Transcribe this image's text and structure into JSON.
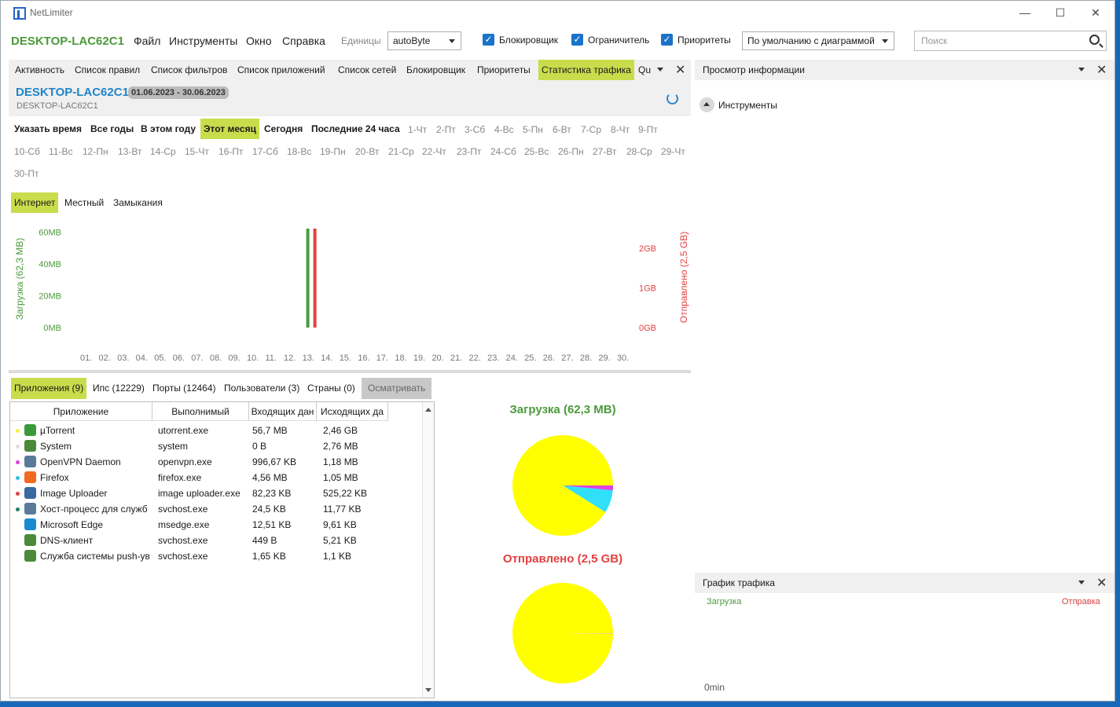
{
  "window": {
    "app_name": "NetLimiter",
    "controls": {
      "minimize": "—",
      "maximize": "☐",
      "close": "✕"
    }
  },
  "menubar": {
    "host": "DESKTOP-LAC62C1",
    "menus": [
      "Файл",
      "Инструменты",
      "Окно",
      "Справка"
    ],
    "units_label": "Единицы",
    "units_value": "autoByte",
    "checkboxes": [
      {
        "label": "Блокировщик",
        "checked": true
      },
      {
        "label": "Ограничитель",
        "checked": true
      },
      {
        "label": "Приоритеты",
        "checked": true
      }
    ],
    "profile_value": "По умолчанию с диаграммой",
    "search_placeholder": "Поиск"
  },
  "tabs": [
    "Активность",
    "Список правил",
    "Список фильтров",
    "Список приложений",
    "Список сетей",
    "Блокировщик",
    "Приоритеты",
    "Статистика трафика",
    "Qu"
  ],
  "active_tab": "Статистика трафика",
  "stats_header": {
    "host": "DESKTOP-LAC62C1",
    "date_range": "01.06.2023 - 30.06.2023",
    "host_sub": "DESKTOP-LAC62C1"
  },
  "range_buttons": [
    "Указать время",
    "Все годы",
    "В этом году",
    "Этот месяц",
    "Сегодня",
    "Последние 24 часа"
  ],
  "active_range": "Этот месяц",
  "days": [
    "1-Чт",
    "2-Пт",
    "3-Сб",
    "4-Вс",
    "5-Пн",
    "6-Вт",
    "7-Ср",
    "8-Чт",
    "9-Пт",
    "10-Сб",
    "11-Вс",
    "12-Пн",
    "13-Вт",
    "14-Ср",
    "15-Чт",
    "16-Пт",
    "17-Сб",
    "18-Вс",
    "19-Пн",
    "20-Вт",
    "21-Ср",
    "22-Чт",
    "23-Пт",
    "24-Сб",
    "25-Вс",
    "26-Пн",
    "27-Вт",
    "28-Ср",
    "29-Чт",
    "30-Пт"
  ],
  "scope_tabs": [
    "Интернет",
    "Местный",
    "Замыкания"
  ],
  "active_scope": "Интернет",
  "chart_data": {
    "type": "bar",
    "categories": [
      "01.",
      "02.",
      "03.",
      "04.",
      "05.",
      "06.",
      "07.",
      "08.",
      "09.",
      "10.",
      "11.",
      "12.",
      "13.",
      "14.",
      "15.",
      "16.",
      "17.",
      "18.",
      "19.",
      "20.",
      "21.",
      "22.",
      "23.",
      "24.",
      "25.",
      "26.",
      "27.",
      "28.",
      "29.",
      "30."
    ],
    "series": [
      {
        "name": "Загрузка (62,3 MB)",
        "color": "#4a9a3a",
        "axis": "left",
        "unit": "MB",
        "values": [
          0,
          0,
          0,
          0,
          0,
          0,
          0,
          0,
          0,
          0,
          0,
          0,
          62.3,
          0,
          0,
          0,
          0,
          0,
          0,
          0,
          0,
          0,
          0,
          0,
          0,
          0,
          0,
          0,
          0,
          0
        ]
      },
      {
        "name": "Отправлено (2,5 GB)",
        "color": "#e34040",
        "axis": "right",
        "unit": "GB",
        "values": [
          0,
          0,
          0,
          0,
          0,
          0,
          0,
          0,
          0,
          0,
          0,
          0,
          2.5,
          0,
          0,
          0,
          0,
          0,
          0,
          0,
          0,
          0,
          0,
          0,
          0,
          0,
          0,
          0,
          0,
          0
        ]
      }
    ],
    "ylabel_left": "Загрузка (62,3 MB)",
    "ylabel_right": "Отправлено (2,5 GB)",
    "yticks_left": [
      "0MB",
      "20MB",
      "40MB",
      "60MB"
    ],
    "yticks_right": [
      "0GB",
      "1GB",
      "2GB"
    ],
    "ylim_left": [
      0,
      62.3
    ],
    "ylim_right": [
      0,
      2.5
    ]
  },
  "bottom_tabs": [
    "Приложения (9)",
    "Ипс (12229)",
    "Порты (12464)",
    "Пользователи (3)",
    "Страны (0)"
  ],
  "active_bottom_tab": "Приложения (9)",
  "inspect_button": "Осматривать",
  "table": {
    "columns": [
      "Приложение",
      "Выполнимый",
      "Входящих дан",
      "Исходящих да"
    ],
    "rows": [
      {
        "name": "µTorrent",
        "exe": "utorrent.exe",
        "in": "56,7 MB",
        "out": "2,46 GB",
        "dot": "#f2f244",
        "icon": "#3a9a3a"
      },
      {
        "name": "System",
        "exe": "system",
        "in": "0 B",
        "out": "2,76 MB",
        "dot": "#e6d6e6",
        "icon": "#4a8a3a"
      },
      {
        "name": "OpenVPN Daemon",
        "exe": "openvpn.exe",
        "in": "996,67 KB",
        "out": "1,18 MB",
        "dot": "#e040e0",
        "icon": "#5a7a9a"
      },
      {
        "name": "Firefox",
        "exe": "firefox.exe",
        "in": "4,56 MB",
        "out": "1,05 MB",
        "dot": "#30c0e0",
        "icon": "#f06a20"
      },
      {
        "name": "Image Uploader",
        "exe": "image uploader.exe",
        "in": "82,23 KB",
        "out": "525,22 KB",
        "dot": "#e04040",
        "icon": "#3a6aa0"
      },
      {
        "name": "Хост-процесс для служб",
        "exe": "svchost.exe",
        "in": "24,5 KB",
        "out": "11,77 KB",
        "dot": "#208060",
        "icon": "#5a7a9a"
      },
      {
        "name": "Microsoft Edge",
        "exe": "msedge.exe",
        "in": "12,51 KB",
        "out": "9,61 KB",
        "dot": "#ffffff",
        "icon": "#1a8ad0"
      },
      {
        "name": "DNS-клиент",
        "exe": "svchost.exe",
        "in": "449 B",
        "out": "5,21 KB",
        "dot": "#ffffff",
        "icon": "#4a8a3a"
      },
      {
        "name": "Служба системы push-ув",
        "exe": "svchost.exe",
        "in": "1,65 KB",
        "out": "1,1 KB",
        "dot": "#ffffff",
        "icon": "#4a8a3a"
      }
    ]
  },
  "pies": [
    {
      "title": "Загрузка (62,3 MB)",
      "color": "#4a9a3a",
      "slices": [
        {
          "label": "µTorrent",
          "value": 56.7,
          "color": "#ffff00"
        },
        {
          "label": "Firefox",
          "value": 4.56,
          "color": "#30e0f8"
        },
        {
          "label": "OpenVPN Daemon",
          "value": 0.97,
          "color": "#e040e0"
        }
      ]
    },
    {
      "title": "Отправлено (2,5 GB)",
      "color": "#e34040",
      "slices": [
        {
          "label": "µTorrent",
          "value": 2460,
          "color": "#ffff00"
        },
        {
          "label": "System",
          "value": 2.76,
          "color": "#e6d6e6"
        },
        {
          "label": "OpenVPN Daemon",
          "value": 1.18,
          "color": "#e040e0"
        }
      ]
    }
  ],
  "info_panel": {
    "title": "Просмотр информации",
    "section": "Инструменты"
  },
  "graph_panel": {
    "title": "График трафика",
    "legend_in": "Загрузка",
    "legend_out": "Отправка",
    "axis_label": "0min"
  }
}
